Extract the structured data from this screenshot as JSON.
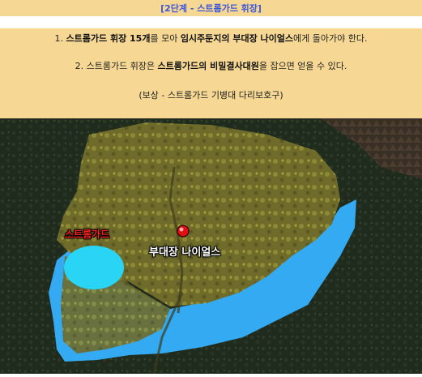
{
  "header": {
    "title": "[2단계 - 스트롬가드 휘장]"
  },
  "quest": {
    "line1": {
      "num": "1.",
      "p1": "스트롬가드 휘장 15개",
      "p2": "를 모아 ",
      "p3": "임시주둔지의 부대장 나이얼스",
      "p4": "에게 돌아가야 한다."
    },
    "line2": {
      "num": "2.",
      "p1": "스트롬가드 휘장은 ",
      "p2": "스트롬가드의 비밀결사대원",
      "p3": "을 잡으면 얻을 수 있다."
    },
    "line3": "(보상 - 스트롬가드 기병대 다리보호구)"
  },
  "map": {
    "area_label": "스트롬가드",
    "npc_label": "부대장 나이얼스",
    "colors": {
      "water": "#33aaf2",
      "land": "#6f6b2a",
      "area": "#29d4f4",
      "marker": "#e01010"
    }
  }
}
